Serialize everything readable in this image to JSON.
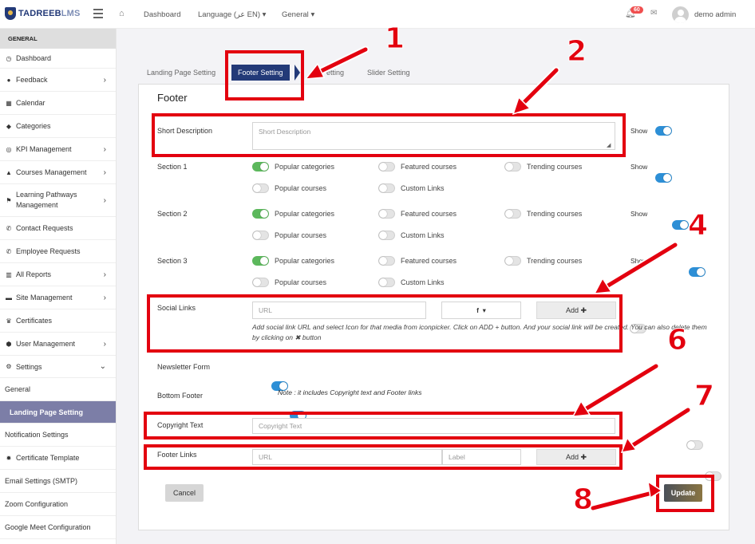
{
  "brand": {
    "name": "TADREEB",
    "suffix": "LMS"
  },
  "nav": {
    "dashboard": "Dashboard",
    "language": "Language (‏عر EN)",
    "general": "General"
  },
  "user": {
    "notifications": "60",
    "name": "demo admin"
  },
  "sidebar": {
    "head": "GENERAL",
    "items": [
      {
        "icon": "◷",
        "label": "Dashboard",
        "chev": ""
      },
      {
        "icon": "●",
        "label": "Feedback",
        "chev": "›"
      },
      {
        "icon": "▦",
        "label": "Calendar",
        "chev": ""
      },
      {
        "icon": "◆",
        "label": "Categories",
        "chev": ""
      },
      {
        "icon": "◎",
        "label": "KPI Management",
        "chev": "›"
      },
      {
        "icon": "▲",
        "label": "Courses Management",
        "chev": "›"
      },
      {
        "icon": "⚑",
        "label": "Learning Pathways Management",
        "chev": "›"
      },
      {
        "icon": "✆",
        "label": "Contact Requests",
        "chev": ""
      },
      {
        "icon": "✆",
        "label": "Employee Requests",
        "chev": ""
      },
      {
        "icon": "▥",
        "label": "All Reports",
        "chev": "›"
      },
      {
        "icon": "▬",
        "label": "Site Management",
        "chev": "›"
      },
      {
        "icon": "♛",
        "label": "Certificates",
        "chev": ""
      },
      {
        "icon": "⬢",
        "label": "User Management",
        "chev": "›"
      },
      {
        "icon": "⚙",
        "label": "Settings",
        "chev": "⌄"
      },
      {
        "icon": "",
        "label": "General",
        "chev": ""
      },
      {
        "icon": "",
        "label": "Landing Page Setting",
        "chev": "",
        "active": true
      },
      {
        "icon": "",
        "label": "Notification Settings",
        "chev": ""
      },
      {
        "icon": "✹",
        "label": "Certificate Template",
        "chev": ""
      },
      {
        "icon": "",
        "label": "Email Settings (SMTP)",
        "chev": ""
      },
      {
        "icon": "",
        "label": "Zoom Configuration",
        "chev": ""
      },
      {
        "icon": "",
        "label": "Google Meet Configuration",
        "chev": ""
      }
    ]
  },
  "tabs": [
    "Landing Page Setting",
    "Footer Setting",
    "etting",
    "Slider Setting"
  ],
  "footer": {
    "title": "Footer",
    "short_desc": {
      "label": "Short Description",
      "placeholder": "Short Description",
      "show": "Show"
    },
    "sections": [
      {
        "label": "Section 1",
        "show": "Show"
      },
      {
        "label": "Section 2",
        "show": "Show"
      },
      {
        "label": "Section 3",
        "show": "Show"
      }
    ],
    "options": {
      "popular_categories": "Popular categories",
      "featured_courses": "Featured courses",
      "trending_courses": "Trending courses",
      "popular_courses": "Popular courses",
      "custom_links": "Custom Links"
    },
    "social": {
      "label": "Social Links",
      "url_placeholder": "URL",
      "icon": "f",
      "add": "Add ✚",
      "help": "Add social link URL and select Icon for that media from iconpicker. Click on ADD + button. And your social link will be created. You can also delete them by clicking on ✖ button"
    },
    "newsletter": "Newsletter Form",
    "bottom_footer": "Bottom Footer",
    "note": "Note : it includes Copyright text and Footer links",
    "copyright": {
      "label": "Copyright Text",
      "placeholder": "Copyright Text"
    },
    "links": {
      "label": "Footer Links",
      "url_placeholder": "URL",
      "label_placeholder": "Label",
      "add": "Add ✚"
    },
    "cancel": "Cancel",
    "update": "Update"
  },
  "callouts": [
    "1",
    "2",
    "4",
    "6",
    "7",
    "8"
  ],
  "colors": {
    "accent": "#233a78",
    "annotation": "#e3000f",
    "update": "#8a7542"
  }
}
